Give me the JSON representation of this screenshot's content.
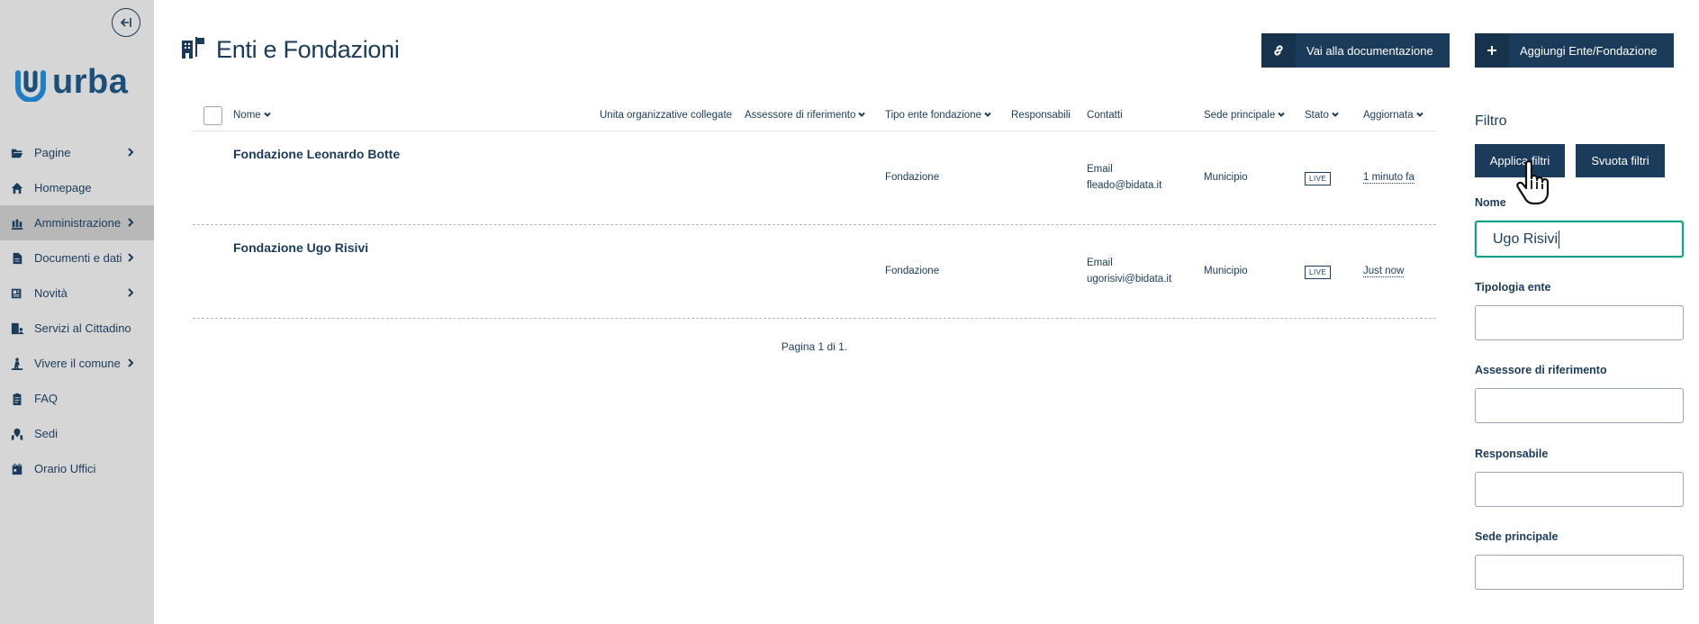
{
  "sidebar": {
    "logo_text": "urba",
    "collapse_icon": "arrow-left-bar-icon",
    "items": [
      {
        "label": "Pagine",
        "icon": "folder-open-icon",
        "has_children": true
      },
      {
        "label": "Homepage",
        "icon": "home-icon",
        "has_children": false
      },
      {
        "label": "Amministrazione",
        "icon": "building-columns-icon",
        "has_children": true,
        "active": true
      },
      {
        "label": "Documenti e dati",
        "icon": "document-icon",
        "has_children": true
      },
      {
        "label": "Novità",
        "icon": "newspaper-icon",
        "has_children": true
      },
      {
        "label": "Servizi al Cittadino",
        "icon": "building-user-icon",
        "has_children": false
      },
      {
        "label": "Vivere il comune",
        "icon": "person-walking-icon",
        "has_children": true
      },
      {
        "label": "FAQ",
        "icon": "clipboard-icon",
        "has_children": false
      },
      {
        "label": "Sedi",
        "icon": "map-location-icon",
        "has_children": false
      },
      {
        "label": "Orario Uffici",
        "icon": "calendar-icon",
        "has_children": false
      }
    ]
  },
  "header": {
    "title": "Enti e Fondazioni",
    "title_icon": "building-flag-icon",
    "doc_button": "Vai alla documentazione",
    "add_button": "Aggiungi Ente/Fondazione"
  },
  "table": {
    "columns": {
      "nome": "Nome",
      "unita": "Unita organizzative collegate",
      "assessore": "Assessore di riferimento",
      "tipo": "Tipo ente fondazione",
      "responsabili": "Responsabili",
      "contatti": "Contatti",
      "sede": "Sede principale",
      "stato": "Stato",
      "aggiornata": "Aggiornata"
    },
    "rows": [
      {
        "name": "Fondazione Leonardo Botte",
        "tipo": "Fondazione",
        "contact_label": "Email",
        "contact_value": "fleado@bidata.it",
        "sede": "Municipio",
        "stato": "LIVE",
        "aggiornata": "1 minuto fa"
      },
      {
        "name": "Fondazione Ugo Risivi",
        "tipo": "Fondazione",
        "contact_label": "Email",
        "contact_value": "ugorisivi@bidata.it",
        "sede": "Municipio",
        "stato": "LIVE",
        "aggiornata": "Just now"
      }
    ],
    "pagination": "Pagina 1 di 1."
  },
  "filter": {
    "title": "Filtro",
    "apply_button": "Applica filtri",
    "clear_button": "Svuota filtri",
    "fields": {
      "nome_label": "Nome",
      "nome_value": "Ugo Risivi",
      "tipologia_label": "Tipologia ente",
      "assessore_label": "Assessore di riferimento",
      "responsabile_label": "Responsabile",
      "sede_label": "Sede principale"
    }
  }
}
